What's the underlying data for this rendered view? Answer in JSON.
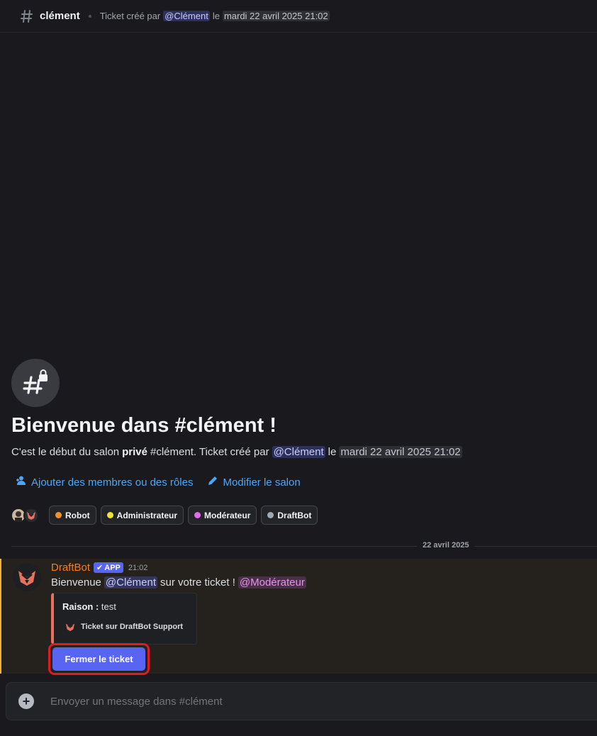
{
  "header": {
    "channel": "clément",
    "topic_prefix": "Ticket créé par",
    "topic_mention": "@Clément",
    "topic_mid": "le",
    "topic_timestamp": "mardi 22 avril 2025 21:02"
  },
  "welcome": {
    "title": "Bienvenue dans #clément !",
    "sub_prefix": "C'est le début du salon",
    "sub_bold": "privé",
    "sub_channel": "#clément. Ticket créé par",
    "sub_mention": "@Clément",
    "sub_mid": "le",
    "sub_timestamp": "mardi 22 avril 2025 21:02",
    "add_members_label": "Ajouter des membres ou des rôles",
    "edit_channel_label": "Modifier le salon"
  },
  "roles": [
    {
      "name": "Robot",
      "color": "#f0922b"
    },
    {
      "name": "Administrateur",
      "color": "#f2e22b"
    },
    {
      "name": "Modérateur",
      "color": "#e26bec"
    },
    {
      "name": "DraftBot",
      "color": "#a0a8b4"
    }
  ],
  "divider_date": "22 avril 2025",
  "message": {
    "author": "DraftBot",
    "badge": "APP",
    "time": "21:02",
    "text_prefix": "Bienvenue",
    "mention_user": "@Clément",
    "text_mid": "sur votre ticket !",
    "mention_role": "@Modérateur",
    "embed": {
      "field_name": "Raison :",
      "field_value": "test",
      "footer": "Ticket sur DraftBot Support",
      "accent": "#e8725e"
    },
    "button_label": "Fermer le ticket"
  },
  "composer": {
    "placeholder": "Envoyer un message dans #clément"
  },
  "colors": {
    "background": "#1a1a1e",
    "brand": "#5865f2",
    "link": "#4fa6f7",
    "highlight": "#f0b132"
  }
}
